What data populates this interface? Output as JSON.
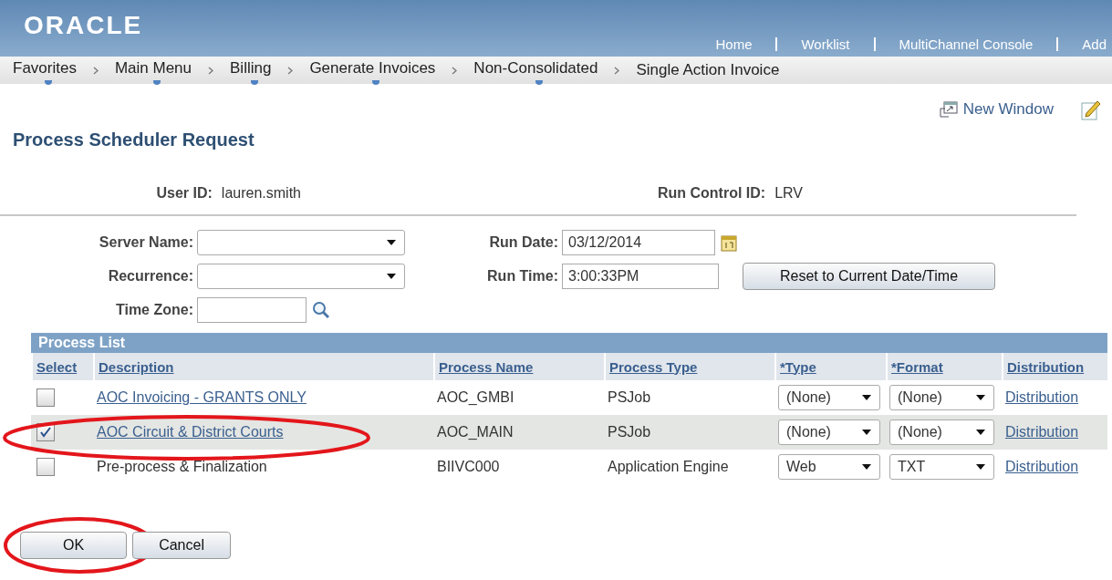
{
  "header": {
    "logo": "ORACLE",
    "links": [
      "Home",
      "Worklist",
      "MultiChannel Console",
      "Add"
    ]
  },
  "breadcrumbs": [
    {
      "label": "Favorites",
      "menu": true
    },
    {
      "label": "Main Menu",
      "menu": true
    },
    {
      "label": "Billing",
      "menu": true
    },
    {
      "label": "Generate Invoices",
      "menu": true
    },
    {
      "label": "Non-Consolidated",
      "menu": true
    },
    {
      "label": "Single Action Invoice",
      "menu": false
    }
  ],
  "new_window": "New Window",
  "title": "Process Scheduler Request",
  "user_id": {
    "label": "User ID:",
    "value": "lauren.smith"
  },
  "run_control_id": {
    "label": "Run Control ID:",
    "value": "LRV"
  },
  "server_name": {
    "label": "Server Name:"
  },
  "recurrence": {
    "label": "Recurrence:"
  },
  "time_zone": {
    "label": "Time Zone:"
  },
  "run_date": {
    "label": "Run Date:",
    "value": "03/12/2014"
  },
  "run_time": {
    "label": "Run Time:",
    "value": "3:00:33PM"
  },
  "reset_button": "Reset to Current Date/Time",
  "process_list": {
    "title": "Process List",
    "columns": [
      "Select",
      "Description",
      "Process Name",
      "Process Type",
      "*Type",
      "*Format",
      "Distribution"
    ],
    "rows": [
      {
        "checked": false,
        "description": "AOC Invoicing - GRANTS ONLY",
        "link": true,
        "process_name": "AOC_GMBI",
        "process_type": "PSJob",
        "type": "(None)",
        "format": "(None)",
        "distribution": "Distribution",
        "highlighted": false,
        "circled": false
      },
      {
        "checked": true,
        "description": "AOC Circuit & District Courts",
        "link": true,
        "process_name": "AOC_MAIN",
        "process_type": "PSJob",
        "type": "(None)",
        "format": "(None)",
        "distribution": "Distribution",
        "highlighted": true,
        "circled": true
      },
      {
        "checked": false,
        "description": "Pre-process & Finalization",
        "link": false,
        "process_name": "BIIVC000",
        "process_type": "Application Engine",
        "type": "Web",
        "format": "TXT",
        "distribution": "Distribution",
        "highlighted": false,
        "circled": false
      }
    ]
  },
  "buttons": [
    {
      "label": "OK",
      "circled": true
    },
    {
      "label": "Cancel",
      "circled": false
    }
  ]
}
